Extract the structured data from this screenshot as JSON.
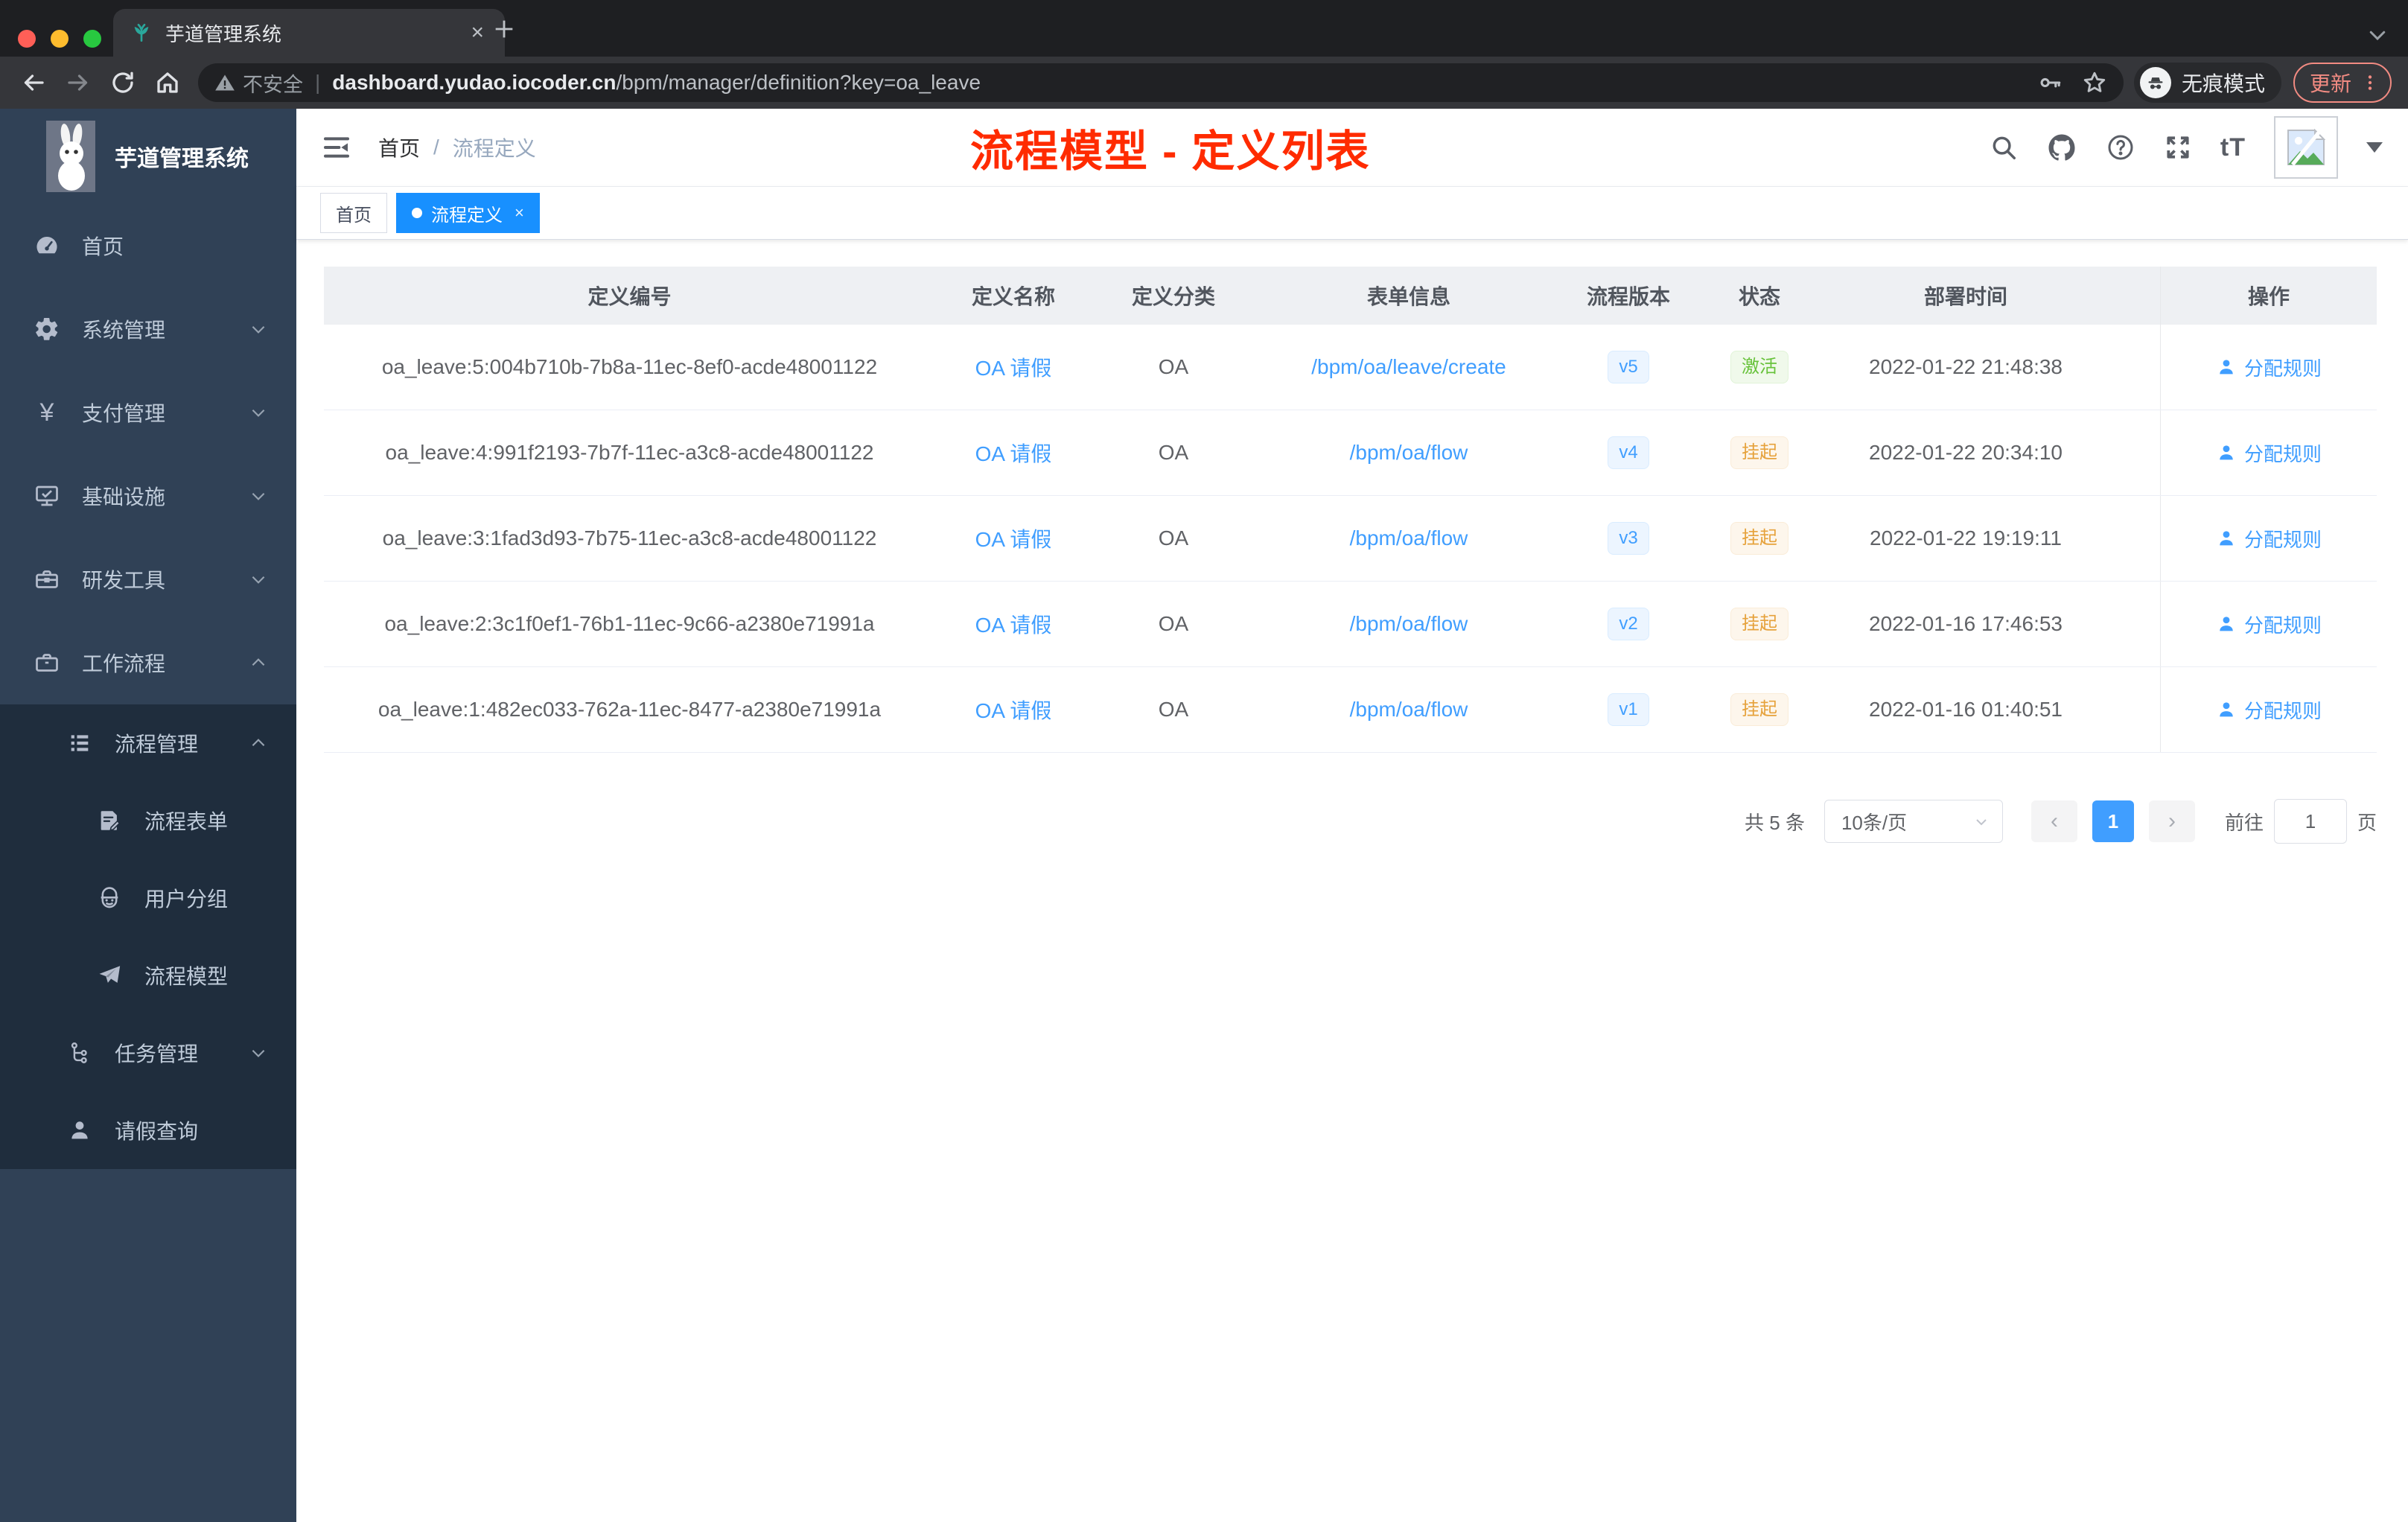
{
  "browser": {
    "tab_title": "芋道管理系统",
    "close_glyph": "×",
    "security_label": "不安全",
    "url_domain": "dashboard.yudao.iocoder.cn",
    "url_path": "/bpm/manager/definition?key=oa_leave",
    "incognito_label": "无痕模式",
    "update_label": "更新"
  },
  "sidebar": {
    "logo_title": "芋道管理系统",
    "yen_glyph": "¥",
    "items": [
      {
        "label": "首页"
      },
      {
        "label": "系统管理"
      },
      {
        "label": "支付管理"
      },
      {
        "label": "基础设施"
      },
      {
        "label": "研发工具"
      },
      {
        "label": "工作流程"
      }
    ],
    "submenu": {
      "group_label": "流程管理",
      "children": [
        {
          "label": "流程表单"
        },
        {
          "label": "用户分组"
        },
        {
          "label": "流程模型"
        }
      ],
      "tasks_label": "任务管理",
      "leave_label": "请假查询"
    }
  },
  "navbar": {
    "breadcrumb_home": "首页",
    "breadcrumb_sep": "/",
    "breadcrumb_current": "流程定义",
    "annotation": "流程模型 - 定义列表",
    "font_size_icon_label": "tT"
  },
  "tags_view": {
    "home_tab": "首页",
    "active_tab": "流程定义",
    "close_glyph": "×"
  },
  "table": {
    "headers": {
      "id": "定义编号",
      "name": "定义名称",
      "category": "定义分类",
      "form": "表单信息",
      "version": "流程版本",
      "status": "状态",
      "time": "部署时间",
      "action": "操作"
    },
    "rows": [
      {
        "id": "oa_leave:5:004b710b-7b8a-11ec-8ef0-acde48001122",
        "name": "OA 请假",
        "category": "OA",
        "form": "/bpm/oa/leave/create",
        "version": "v5",
        "status": "激活",
        "time": "2022-01-22 21:48:38",
        "action": "分配规则"
      },
      {
        "id": "oa_leave:4:991f2193-7b7f-11ec-a3c8-acde48001122",
        "name": "OA 请假",
        "category": "OA",
        "form": "/bpm/oa/flow",
        "version": "v4",
        "status": "挂起",
        "time": "2022-01-22 20:34:10",
        "action": "分配规则"
      },
      {
        "id": "oa_leave:3:1fad3d93-7b75-11ec-a3c8-acde48001122",
        "name": "OA 请假",
        "category": "OA",
        "form": "/bpm/oa/flow",
        "version": "v3",
        "status": "挂起",
        "time": "2022-01-22 19:19:11",
        "action": "分配规则"
      },
      {
        "id": "oa_leave:2:3c1f0ef1-76b1-11ec-9c66-a2380e71991a",
        "name": "OA 请假",
        "category": "OA",
        "form": "/bpm/oa/flow",
        "version": "v2",
        "status": "挂起",
        "time": "2022-01-16 17:46:53",
        "action": "分配规则"
      },
      {
        "id": "oa_leave:1:482ec033-762a-11ec-8477-a2380e71991a",
        "name": "OA 请假",
        "category": "OA",
        "form": "/bpm/oa/flow",
        "version": "v1",
        "status": "挂起",
        "time": "2022-01-16 01:40:51",
        "action": "分配规则"
      }
    ]
  },
  "pagination": {
    "total": "共 5 条",
    "page_size": "10条/页",
    "prev_glyph": "‹",
    "current_page": "1",
    "next_glyph": "›",
    "goto_label": "前往",
    "goto_value": "1",
    "unit_label": "页"
  },
  "colors": {
    "accent_link": "#409eff",
    "tab_active": "#1890ff",
    "annotation_red": "#ff2b00",
    "status_active_green": "#67c23a",
    "status_suspend_orange": "#e6a23c",
    "sidebar_bg": "#304156",
    "submenu_bg": "#1f2d3d"
  }
}
